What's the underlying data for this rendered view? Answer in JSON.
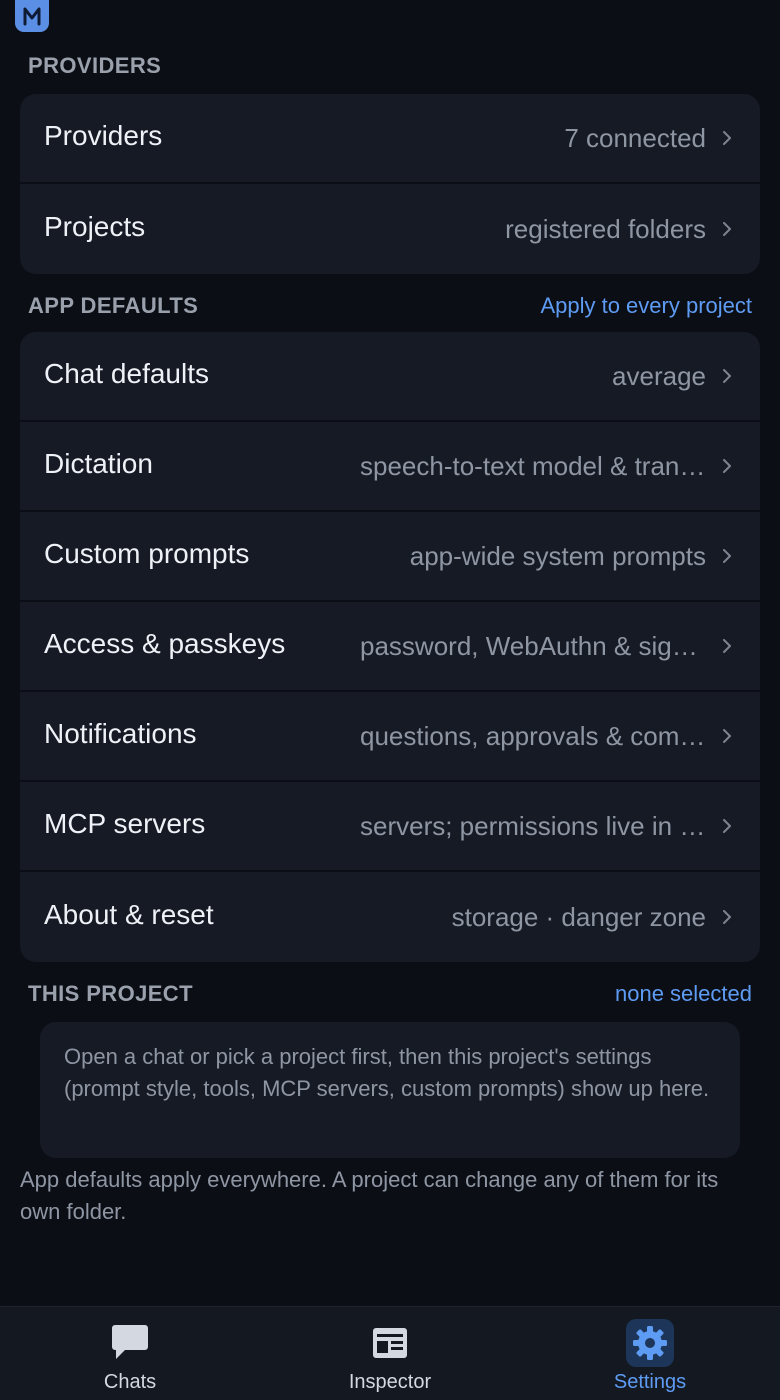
{
  "app": {
    "logo_letter": "M",
    "colors": {
      "background": "#0b0e15",
      "card": "#161a25",
      "accent": "#5e9bf3",
      "logo": "#5b8fe6",
      "muted_text": "#8f96a3",
      "section_title": "#9aa1ad"
    }
  },
  "providers_section": {
    "title": "PROVIDERS",
    "rows": [
      {
        "label": "Providers",
        "value": "7 connected"
      },
      {
        "label": "Projects",
        "value": "registered folders"
      }
    ]
  },
  "app_defaults_section": {
    "title": "APP DEFAULTS",
    "action": "Apply to every project",
    "rows": [
      {
        "label": "Chat defaults",
        "value": "average"
      },
      {
        "label": "Dictation",
        "value": "speech-to-text model & transcription"
      },
      {
        "label": "Custom prompts",
        "value": "app-wide system prompts"
      },
      {
        "label": "Access & passkeys",
        "value": "password, WebAuthn & sign-in"
      },
      {
        "label": "Notifications",
        "value": "questions, approvals & completions"
      },
      {
        "label": "MCP servers",
        "value": "servers; permissions live in projects"
      },
      {
        "label": "About & reset",
        "value": "storage · danger zone"
      }
    ]
  },
  "this_project_section": {
    "title": "THIS PROJECT",
    "status": "none selected",
    "notice": "Open a chat or pick a project first, then this project's settings (prompt style, tools, MCP servers, custom prompts) show up here."
  },
  "footnote": "App defaults apply everywhere. A project can change any of them for its own folder.",
  "tabbar": {
    "tabs": [
      {
        "label": "Chats",
        "icon": "chat-bubble-icon",
        "active": false
      },
      {
        "label": "Inspector",
        "icon": "inspector-icon",
        "active": false
      },
      {
        "label": "Settings",
        "icon": "gear-icon",
        "active": true
      }
    ]
  }
}
